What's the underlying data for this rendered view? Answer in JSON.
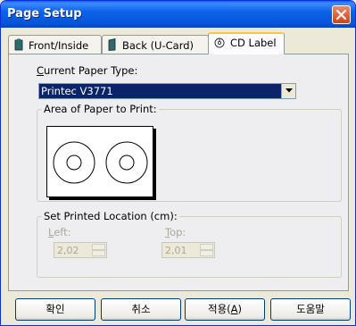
{
  "window": {
    "title": "Page Setup"
  },
  "tabs": [
    {
      "label": "Front/Inside",
      "icon": "document-icon"
    },
    {
      "label": "Back (U-Card)",
      "icon": "book-icon"
    },
    {
      "label": "CD Label",
      "icon": "cd-icon",
      "active": true
    }
  ],
  "paper": {
    "label_prefix": "C",
    "label_rest": "urrent Paper Type:",
    "selected": "Printec V3771"
  },
  "area": {
    "legend": "Area of Paper to Print:",
    "discs": 2
  },
  "location": {
    "legend": "Set Printed Location (cm):",
    "left_key": "L",
    "left_rest": "eft:",
    "left_value": "2,02",
    "top_key": "T",
    "top_rest": "op:",
    "top_value": "2,01"
  },
  "buttons": {
    "ok": "확인",
    "cancel": "취소",
    "apply_text": "적용(",
    "apply_key": "A",
    "apply_close": ")",
    "help": "도움말"
  },
  "colors": {
    "title_bar": "#0553d6",
    "selection": "#0a246a",
    "active_tab_accent": "#ffc83c",
    "close_button": "#d1401a"
  }
}
